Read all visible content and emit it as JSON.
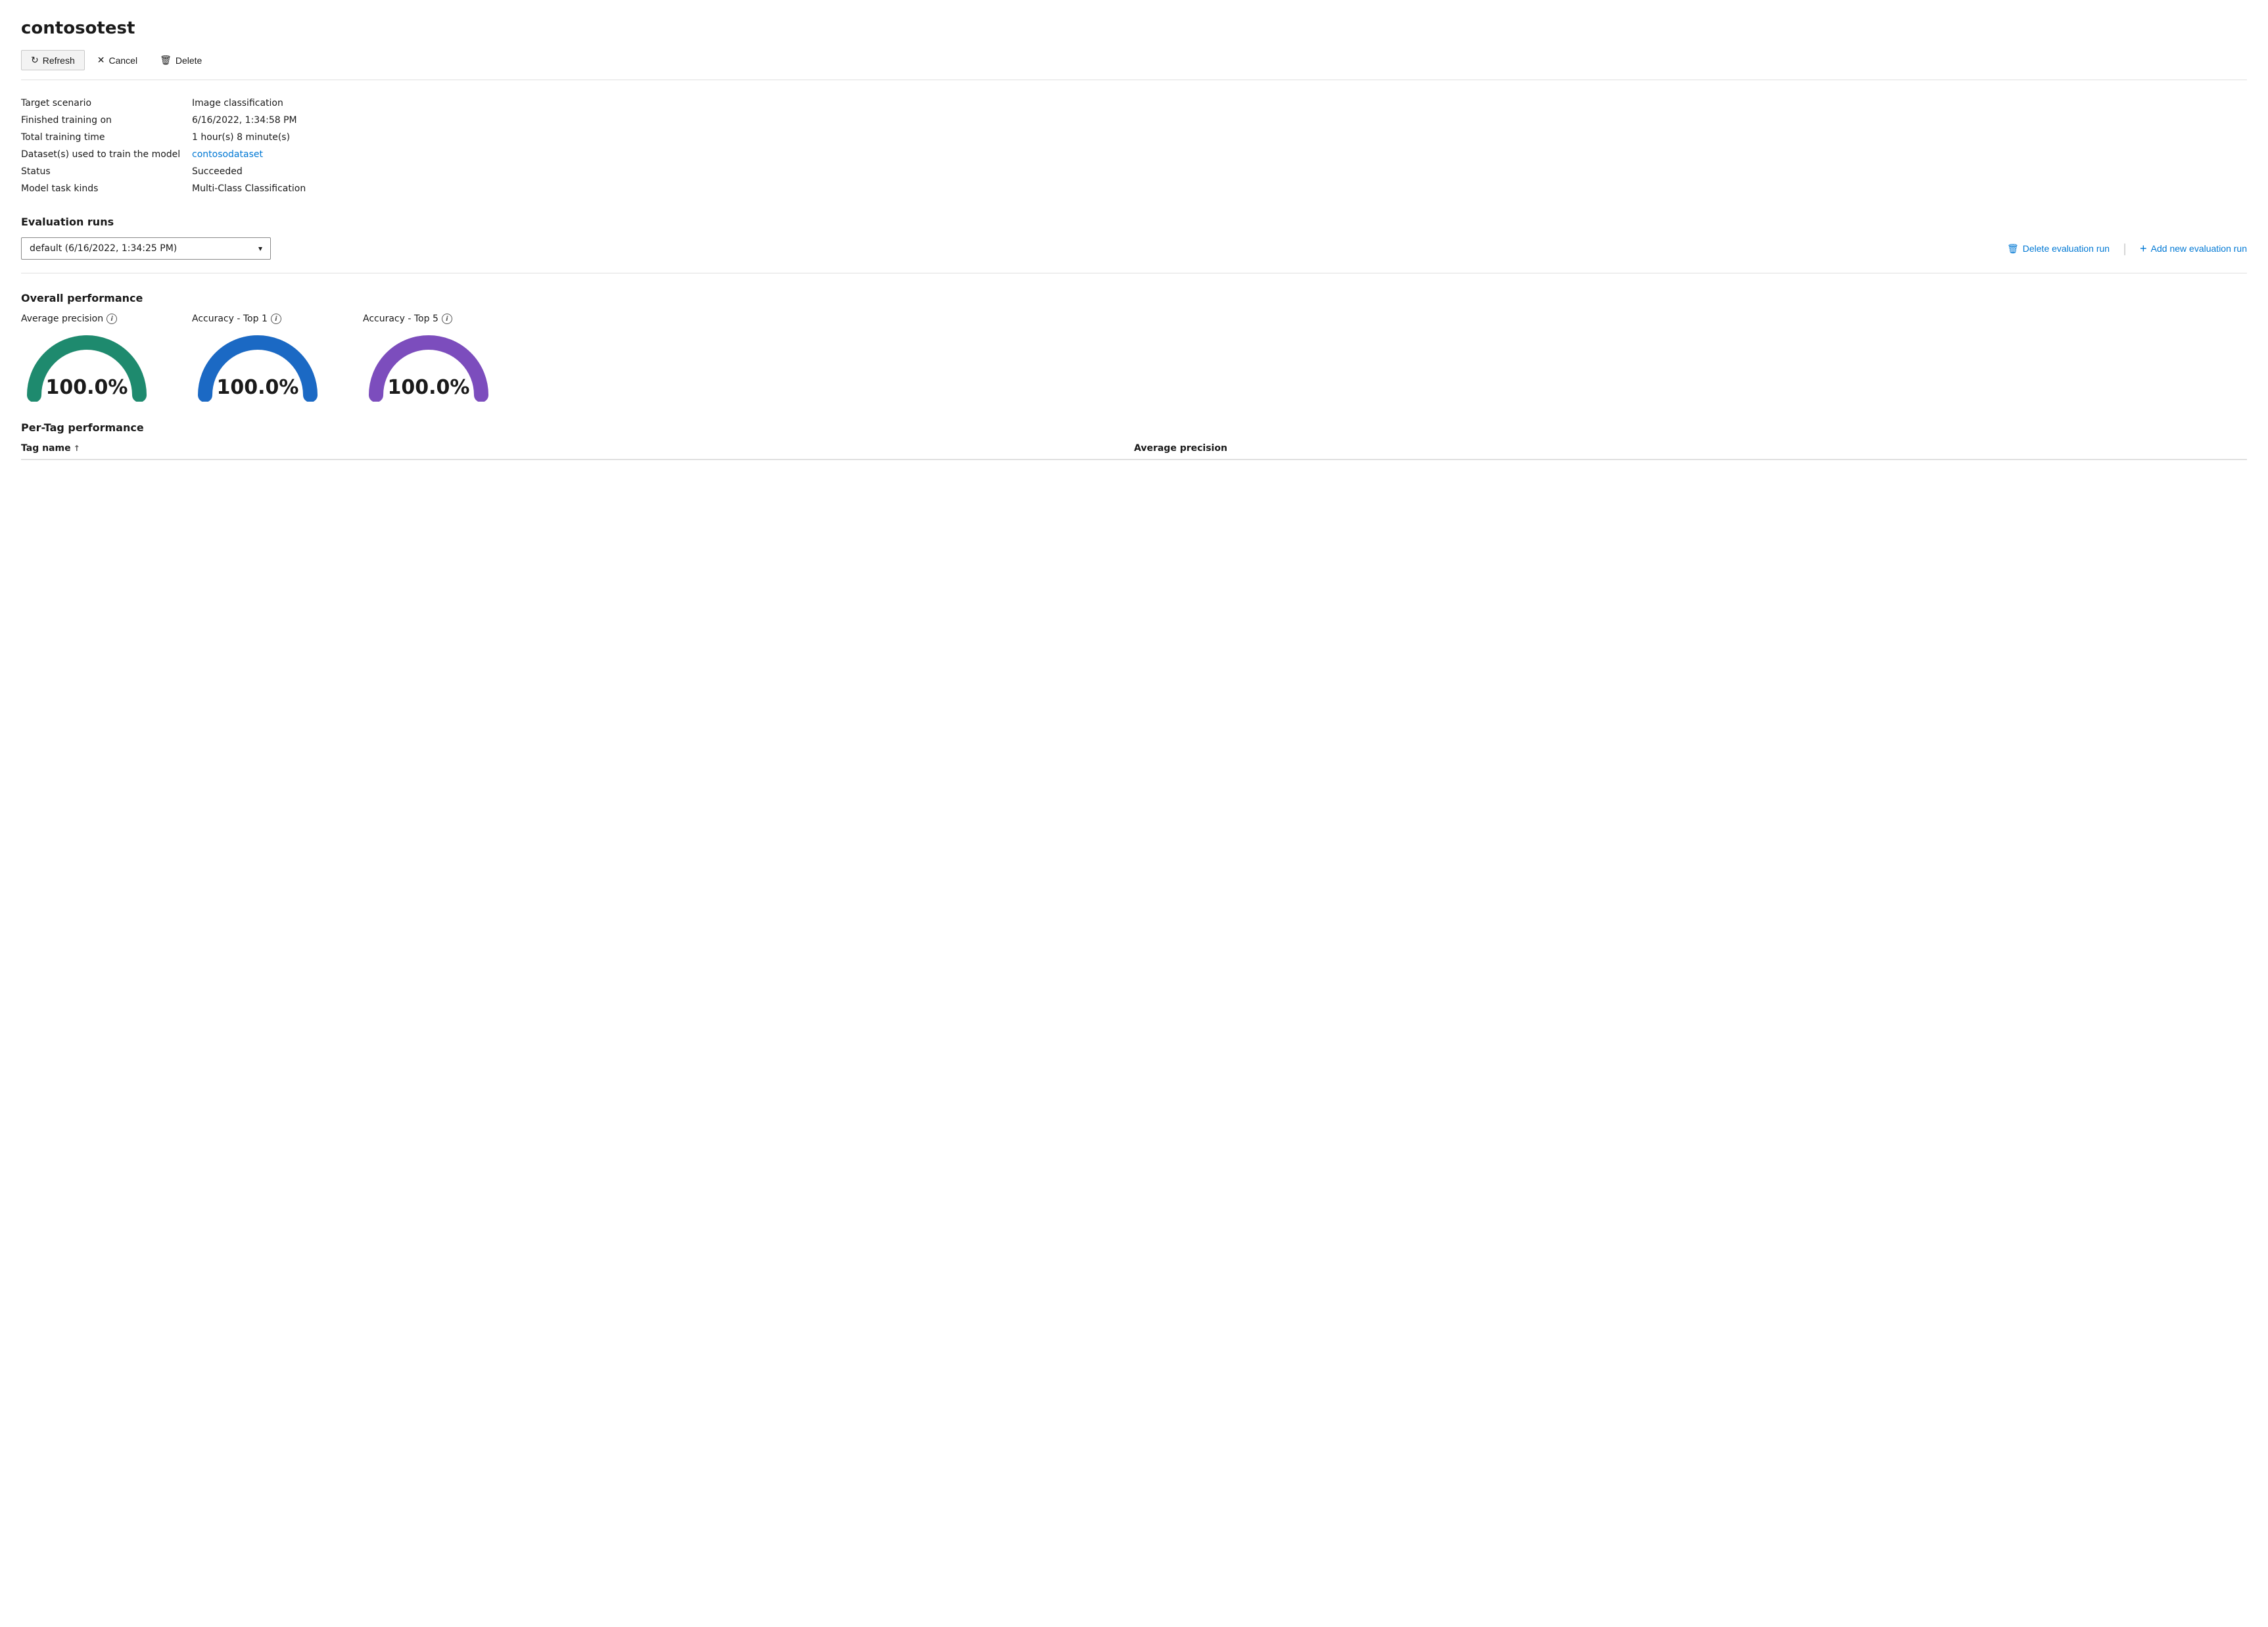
{
  "page": {
    "title": "contosotest"
  },
  "toolbar": {
    "refresh_label": "Refresh",
    "cancel_label": "Cancel",
    "delete_label": "Delete",
    "refresh_icon": "↻",
    "cancel_icon": "✕",
    "delete_icon": "🗑"
  },
  "details": {
    "rows": [
      {
        "label": "Target scenario",
        "value": "Image classification",
        "is_link": false
      },
      {
        "label": "Finished training on",
        "value": "6/16/2022, 1:34:58 PM",
        "is_link": false
      },
      {
        "label": "Total training time",
        "value": "1 hour(s) 8 minute(s)",
        "is_link": false
      },
      {
        "label": "Dataset(s) used to train the model",
        "value": "contosodataset",
        "is_link": true
      },
      {
        "label": "Status",
        "value": "Succeeded",
        "is_link": false
      },
      {
        "label": "Model task kinds",
        "value": "Multi-Class Classification",
        "is_link": false
      }
    ]
  },
  "evaluation_runs": {
    "section_title": "Evaluation runs",
    "dropdown_value": "default (6/16/2022, 1:34:25 PM)",
    "delete_btn": "Delete evaluation run",
    "add_btn": "Add new evaluation run"
  },
  "overall_performance": {
    "section_title": "Overall performance",
    "gauges": [
      {
        "label": "Average precision",
        "value": "100.0%",
        "color": "#1e8a6e"
      },
      {
        "label": "Accuracy - Top 1",
        "value": "100.0%",
        "color": "#1b69c4"
      },
      {
        "label": "Accuracy - Top 5",
        "value": "100.0%",
        "color": "#7c4dbd"
      }
    ]
  },
  "per_tag_performance": {
    "section_title": "Per-Tag performance",
    "columns": [
      {
        "label": "Tag name",
        "sortable": true,
        "sort_dir": "asc"
      },
      {
        "label": "Average precision",
        "sortable": false
      }
    ]
  }
}
